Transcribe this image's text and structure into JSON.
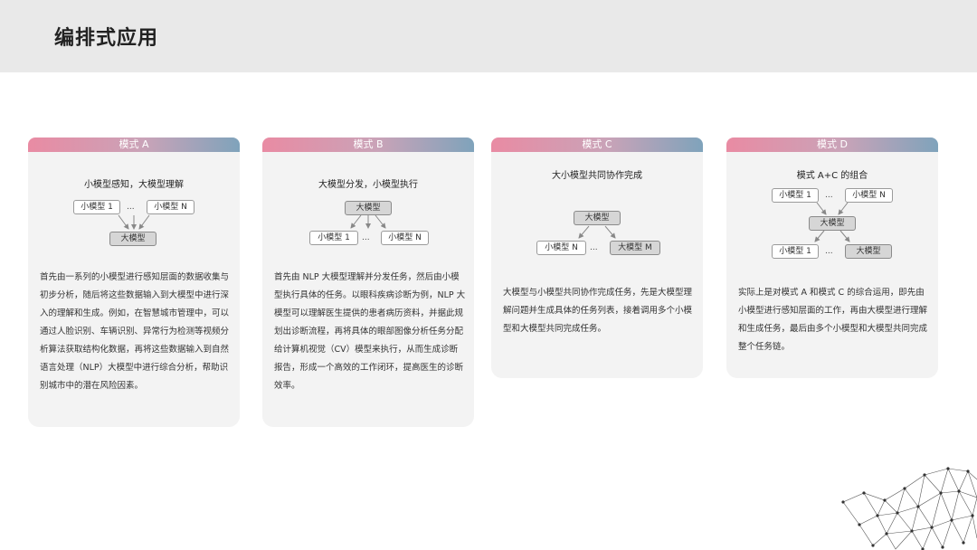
{
  "page": {
    "title": "编排式应用"
  },
  "cards": [
    {
      "header": "模式 A",
      "subtitle": "小模型感知，大模型理解",
      "nodes": {
        "n1": "小模型 1",
        "dots": "...",
        "n2": "小模型 N",
        "n3": "大模型"
      },
      "desc": "首先由一系列的小模型进行感知层面的数据收集与初步分析，随后将这些数据输入到大模型中进行深入的理解和生成。例如，在智慧城市管理中，可以通过人脸识别、车辆识别、异常行为检测等视频分析算法获取结构化数据，再将这些数据输入到自然语言处理（NLP）大模型中进行综合分析，帮助识别城市中的潜在风险因素。"
    },
    {
      "header": "模式 B",
      "subtitle": "大模型分发，小模型执行",
      "nodes": {
        "n1": "大模型",
        "n2": "小模型 1",
        "dots": "...",
        "n3": "小模型 N"
      },
      "desc": "首先由 NLP 大模型理解并分发任务，然后由小模型执行具体的任务。以眼科疾病诊断为例，NLP 大模型可以理解医生提供的患者病历资料，并据此规划出诊断流程，再将具体的眼部图像分析任务分配给计算机视觉（CV）模型来执行，从而生成诊断报告，形成一个高效的工作闭环，提高医生的诊断效率。"
    },
    {
      "header": "模式 C",
      "subtitle": "大小模型共同协作完成",
      "nodes": {
        "n1": "大模型",
        "n2": "小模型 N",
        "dots": "...",
        "n3": "大模型 M"
      },
      "desc": "大模型与小模型共同协作完成任务，先是大模型理解问题并生成具体的任务列表，接着调用多个小模型和大模型共同完成任务。"
    },
    {
      "header": "模式 D",
      "subtitle": "模式 A+C 的组合",
      "nodes": {
        "n1": "小模型 1",
        "dots1": "...",
        "n2": "小模型 N",
        "n3": "大模型",
        "n4": "小模型 1",
        "dots2": "...",
        "n5": "大模型"
      },
      "desc": "实际上是对模式 A 和模式 C 的综合运用，即先由小模型进行感知层面的工作，再由大模型进行理解和生成任务，最后由多个小模型和大模型共同完成整个任务链。"
    }
  ]
}
